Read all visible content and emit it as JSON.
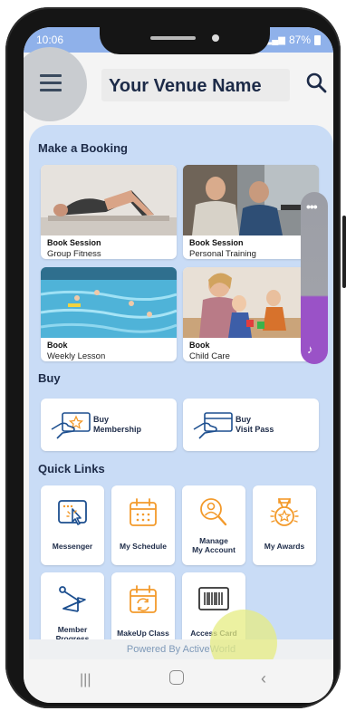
{
  "status_bar": {
    "time": "10:06",
    "battery": "87%"
  },
  "header": {
    "title": "Your Venue Name",
    "menu_icon": "hamburger-icon",
    "search_icon": "search-icon"
  },
  "booking": {
    "title": "Make a Booking",
    "cards": [
      {
        "line1": "Book Session",
        "line2": "Group Fitness"
      },
      {
        "line1": "Book Session",
        "line2": "Personal Training"
      },
      {
        "line1": "Book",
        "line2": "Weekly Lesson"
      },
      {
        "line1": "Book",
        "line2": "Child Care"
      }
    ]
  },
  "buy": {
    "title": "Buy",
    "items": [
      {
        "line1": "Buy",
        "line2": "Membership",
        "icon": "star-card-icon"
      },
      {
        "line1": "Buy",
        "line2": "Visit Pass",
        "icon": "card-hand-icon"
      }
    ]
  },
  "quick_links": {
    "title": "Quick Links",
    "items": [
      {
        "label": "Messenger",
        "icon": "messenger-icon"
      },
      {
        "label": "My Schedule",
        "icon": "calendar-icon"
      },
      {
        "label": "Manage My Account",
        "line1": "Manage",
        "line2": "My Account",
        "icon": "magnifier-person-icon"
      },
      {
        "label": "My Awards",
        "icon": "medal-icon"
      },
      {
        "label": "Member Progress",
        "line1": "Member",
        "line2": "Progress",
        "icon": "progress-flag-icon"
      },
      {
        "label": "MakeUp Class",
        "icon": "calendar-refresh-icon"
      },
      {
        "label": "Access Card",
        "icon": "barcode-icon"
      }
    ]
  },
  "footer": {
    "powered_by": "Powered By ActiveWorld"
  },
  "colors": {
    "accent": "#f39a2b",
    "primary": "#1d4f8f",
    "panel": "#c9dcf6",
    "status_bar": "#8fb1ea",
    "widget_purple": "#9a52c7"
  }
}
